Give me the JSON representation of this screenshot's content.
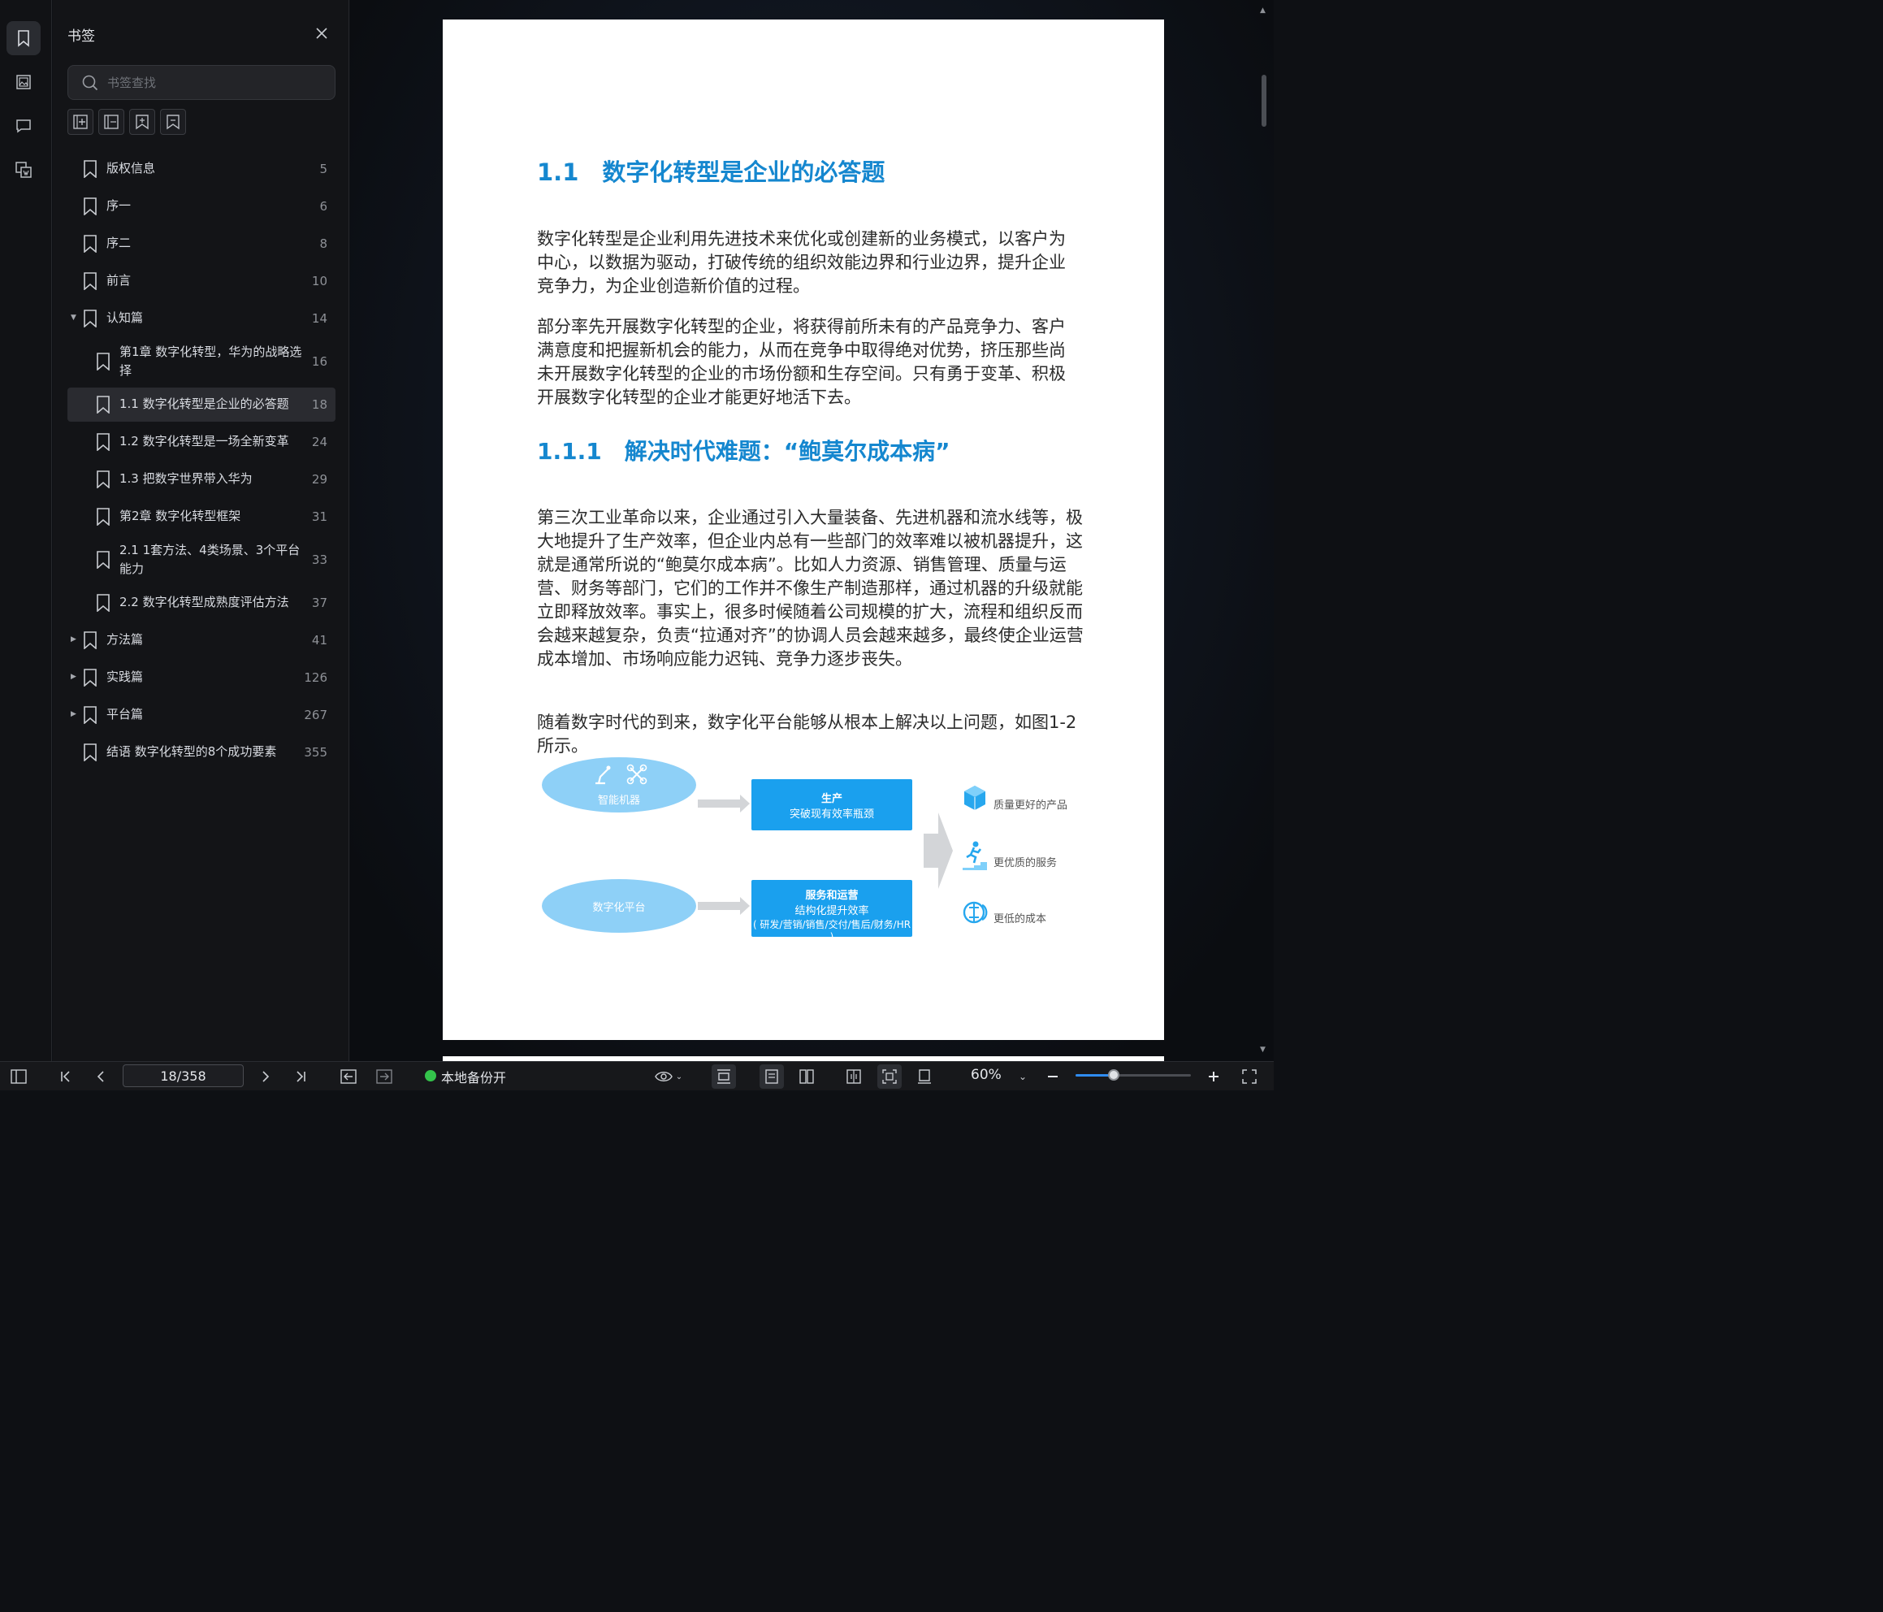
{
  "panel": {
    "title": "书签",
    "search_placeholder": "书签查找"
  },
  "bookmarks": [
    {
      "label": "版权信息",
      "page": "5",
      "level": 0,
      "caret": ""
    },
    {
      "label": "序一",
      "page": "6",
      "level": 0,
      "caret": ""
    },
    {
      "label": "序二",
      "page": "8",
      "level": 0,
      "caret": ""
    },
    {
      "label": "前言",
      "page": "10",
      "level": 0,
      "caret": ""
    },
    {
      "label": "认知篇",
      "page": "14",
      "level": 0,
      "caret": "▼"
    },
    {
      "label": "第1章 数字化转型，华为的战略选择",
      "page": "16",
      "level": 1,
      "caret": ""
    },
    {
      "label": "1.1 数字化转型是企业的必答题",
      "page": "18",
      "level": 1,
      "caret": "",
      "selected": true
    },
    {
      "label": "1.2 数字化转型是一场全新变革",
      "page": "24",
      "level": 1,
      "caret": ""
    },
    {
      "label": "1.3 把数字世界带入华为",
      "page": "29",
      "level": 1,
      "caret": ""
    },
    {
      "label": "第2章 数字化转型框架",
      "page": "31",
      "level": 1,
      "caret": ""
    },
    {
      "label": "2.1 1套方法、4类场景、3个平台能力",
      "page": "33",
      "level": 1,
      "caret": ""
    },
    {
      "label": "2.2 数字化转型成熟度评估方法",
      "page": "37",
      "level": 1,
      "caret": ""
    },
    {
      "label": "方法篇",
      "page": "41",
      "level": 0,
      "caret": "▶"
    },
    {
      "label": "实践篇",
      "page": "126",
      "level": 0,
      "caret": "▶"
    },
    {
      "label": "平台篇",
      "page": "267",
      "level": 0,
      "caret": "▶"
    },
    {
      "label": "结语 数字化转型的8个成功要素",
      "page": "355",
      "level": 0,
      "caret": ""
    }
  ],
  "document": {
    "heading1": "1.1 数字化转型是企业的必答题",
    "para1": "数字化转型是企业利用先进技术来优化或创建新的业务模式，以客户为中心，以数据为驱动，打破传统的组织效能边界和行业边界，提升企业竞争力，为企业创造新价值的过程。",
    "para2": "部分率先开展数字化转型的企业，将获得前所未有的产品竞争力、客户满意度和把握新机会的能力，从而在竞争中取得绝对优势，挤压那些尚未开展数字化转型的企业的市场份额和生存空间。只有勇于变革、积极开展数字化转型的企业才能更好地活下去。",
    "heading2": "1.1.1 解决时代难题：“鲍莫尔成本病”",
    "para3": "第三次工业革命以来，企业通过引入大量装备、先进机器和流水线等，极大地提升了生产效率，但企业内总有一些部门的效率难以被机器提升，这就是通常所说的“鲍莫尔成本病”。比如人力资源、销售管理、质量与运营、财务等部门，它们的工作并不像生产制造那样，通过机器的升级就能立即释放效率。事实上，很多时候随着公司规模的扩大，流程和组织反而会越来越复杂，负责“拉通对齐”的协调人员会越来越多，最终使企业运营成本增加、市场响应能力迟钝、竞争力逐步丧失。",
    "para4": "随着数字时代的到来，数字化平台能够从根本上解决以上问题，如图1-2所示。",
    "figure": {
      "ellipse1": "智能机器",
      "ellipse2": "数字化平台",
      "box1_title": "生产",
      "box1_sub": "突破现有效率瓶颈",
      "box2_title": "服务和运营",
      "box2_sub": "结构化提升效率",
      "box2_sub2": "( 研发/营销/销售/交付/售后/财务/HR )",
      "result1": "质量更好的产品",
      "result2": "更优质的服务",
      "result3": "更低的成本"
    }
  },
  "bottombar": {
    "page_value": "18/358",
    "backup_label": "本地备份开",
    "zoom_label": "60%",
    "zoom_level": 0.33,
    "status_color": "#34c34b"
  }
}
